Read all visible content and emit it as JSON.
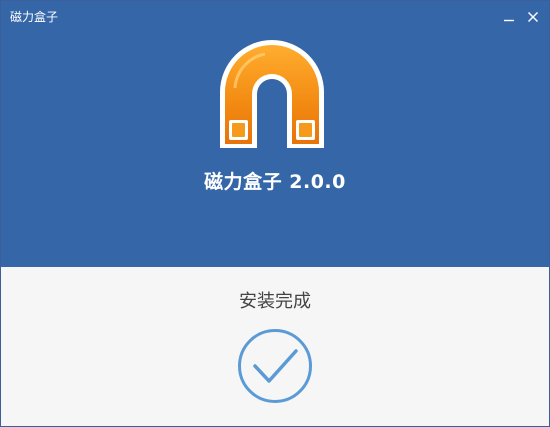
{
  "window": {
    "title": "磁力盒子"
  },
  "header": {
    "app_name": "磁力盒子 2.0.0",
    "logo_icon": "magnet-icon",
    "background_color": "#3566a8"
  },
  "status": {
    "text": "安装完成",
    "icon": "checkmark-circle-icon",
    "accent_color": "#5b9bd5"
  },
  "controls": {
    "minimize_icon": "minimize-icon",
    "close_icon": "close-icon"
  }
}
